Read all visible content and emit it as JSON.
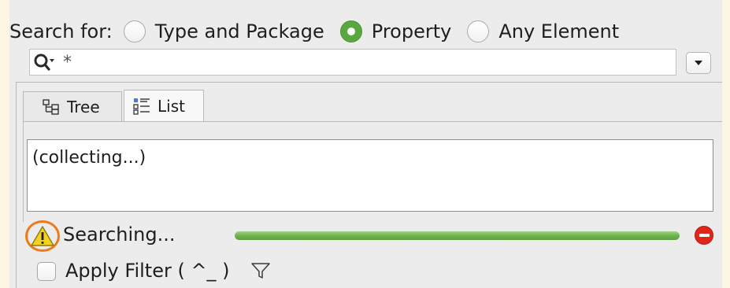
{
  "search_for": {
    "label": "Search for:",
    "options": [
      {
        "label": "Type and Package",
        "selected": false
      },
      {
        "label": "Property",
        "selected": true
      },
      {
        "label": "Any Element",
        "selected": false
      }
    ]
  },
  "search": {
    "value": "",
    "placeholder": "*"
  },
  "tabs": [
    {
      "label": "Tree",
      "active": false
    },
    {
      "label": "List",
      "active": true
    }
  ],
  "results": {
    "status_text": "(collecting...)"
  },
  "status": {
    "text": "Searching...",
    "progress": 1.0
  },
  "filter": {
    "label": "Apply Filter ( ^_ )",
    "checked": false
  },
  "icons": {
    "search": "search-icon",
    "dropdown": "chevron-down-icon",
    "warning": "warning-icon",
    "stop": "stop-icon",
    "filter": "filter-icon",
    "tree": "tree-view-icon",
    "list": "list-view-icon"
  },
  "colors": {
    "accent_green": "#5aa63f",
    "progress_green": "#6bb04b",
    "warning_highlight": "#ef7a1a",
    "stop_red": "#e0261b",
    "background": "#fdf6e3"
  }
}
